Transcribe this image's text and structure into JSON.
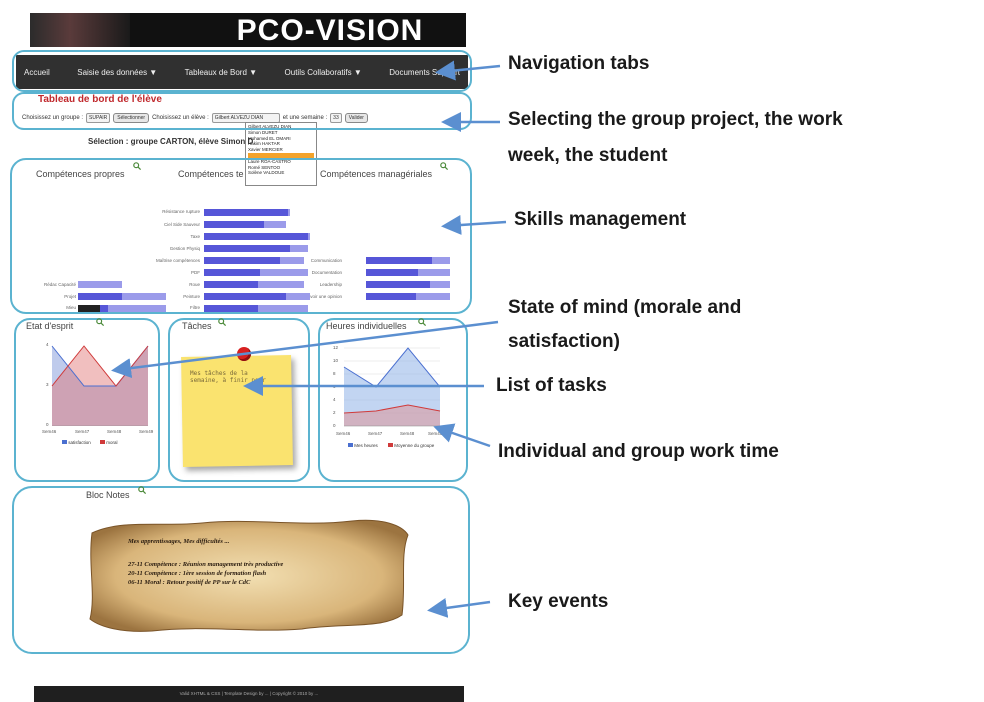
{
  "header": {
    "title": "PCO-VISION"
  },
  "nav": {
    "items": [
      {
        "label": "Accueil",
        "caret": ""
      },
      {
        "label": "Saisie des données",
        "caret": "▼"
      },
      {
        "label": "Tableaux de Bord",
        "caret": "▼"
      },
      {
        "label": "Outils Collaboratifs",
        "caret": "▼"
      },
      {
        "label": "Documents Support",
        "caret": ""
      }
    ]
  },
  "selection_panel": {
    "title": "Tableau de bord de l'élève",
    "group_label": "Choisissez un groupe :",
    "group_value": "SUPAIR",
    "select_button": "Sélectionner",
    "student_label": "Choisissez un élève :",
    "student_value": "Gilbert ALVEZU DIAN",
    "week_label": "et une semaine :",
    "week_value": "33",
    "validate_button": "Valider",
    "dropdown_options": [
      "Gilbert ALVEZU DIAN",
      "Simon DURET",
      "Mohamed EL OMARI",
      "Hakim HAKTAR",
      "Xavier MERCIER",
      "",
      "Laure ROA-CASTRO",
      "Romé SENTOO",
      "Solène VALDOUE"
    ],
    "selection_text": "Sélection : groupe CARTON, élève Simon D"
  },
  "skills": {
    "titles": [
      "Compétences propres",
      "Compétences te",
      "Compétences managériales"
    ],
    "technical_labels": [
      "Résistance rupture",
      "Ciel Side Sauveur",
      "Taxe",
      "Gestion Physiq",
      "Maîtrise compétences",
      "PDF",
      "Roue",
      "Peinture",
      "Filtre"
    ],
    "managerial_labels": [
      "Communication",
      "Documentation",
      "Leadership",
      "Savoir une opinion"
    ],
    "own_labels": [
      "Rédac Capacité",
      "Projet",
      "Mieu"
    ]
  },
  "morale": {
    "title": "Etat d'esprit",
    "weeks": [
      "Sem46",
      "Sem47",
      "Sem48",
      "Sem49"
    ],
    "yticks": [
      "4",
      "3",
      "0"
    ],
    "legend": [
      "satisfaction",
      "moral"
    ]
  },
  "tasks": {
    "title": "Tâches",
    "note": "Mes tâches de la semaine, à finir pour"
  },
  "work_time": {
    "title": "Heures individuelles",
    "weeks": [
      "Sem46",
      "Sem47",
      "Sem48",
      "Sem49"
    ],
    "yticks": [
      "12",
      "10",
      "8",
      "6",
      "4",
      "2",
      "0"
    ],
    "legend": [
      "Mes heures",
      "Moyenne du groupe"
    ]
  },
  "notes": {
    "title": "Bloc Notes",
    "heading": "Mes apprentissages, Mes difficultés ...",
    "lines": [
      "27-11 Compétence : Réunion management très productive",
      "20-11 Compétence : 1ère session de formation flash",
      "06-11 Moral : Retour positif de PP sur le CdC"
    ]
  },
  "footer": {
    "text": "Valid XHTML & CSS | Template Design by ... | Copyright © 2010 by ..."
  },
  "annotations": {
    "nav": "Navigation tabs",
    "select_line1": "Selecting the group project, the work",
    "select_line2": "week, the student",
    "skills": "Skills management",
    "mind_line1": "State of mind (morale and",
    "mind_line2": "satisfaction)",
    "tasks": "List of tasks",
    "work": "Individual and group work time",
    "events": "Key events"
  },
  "colors": {
    "frame": "#5bb3d0",
    "arrow": "#5b8fd0",
    "bar_dark": "#5b5bd8",
    "bar_light": "#9b9bea",
    "accent_red": "#c0282c"
  }
}
